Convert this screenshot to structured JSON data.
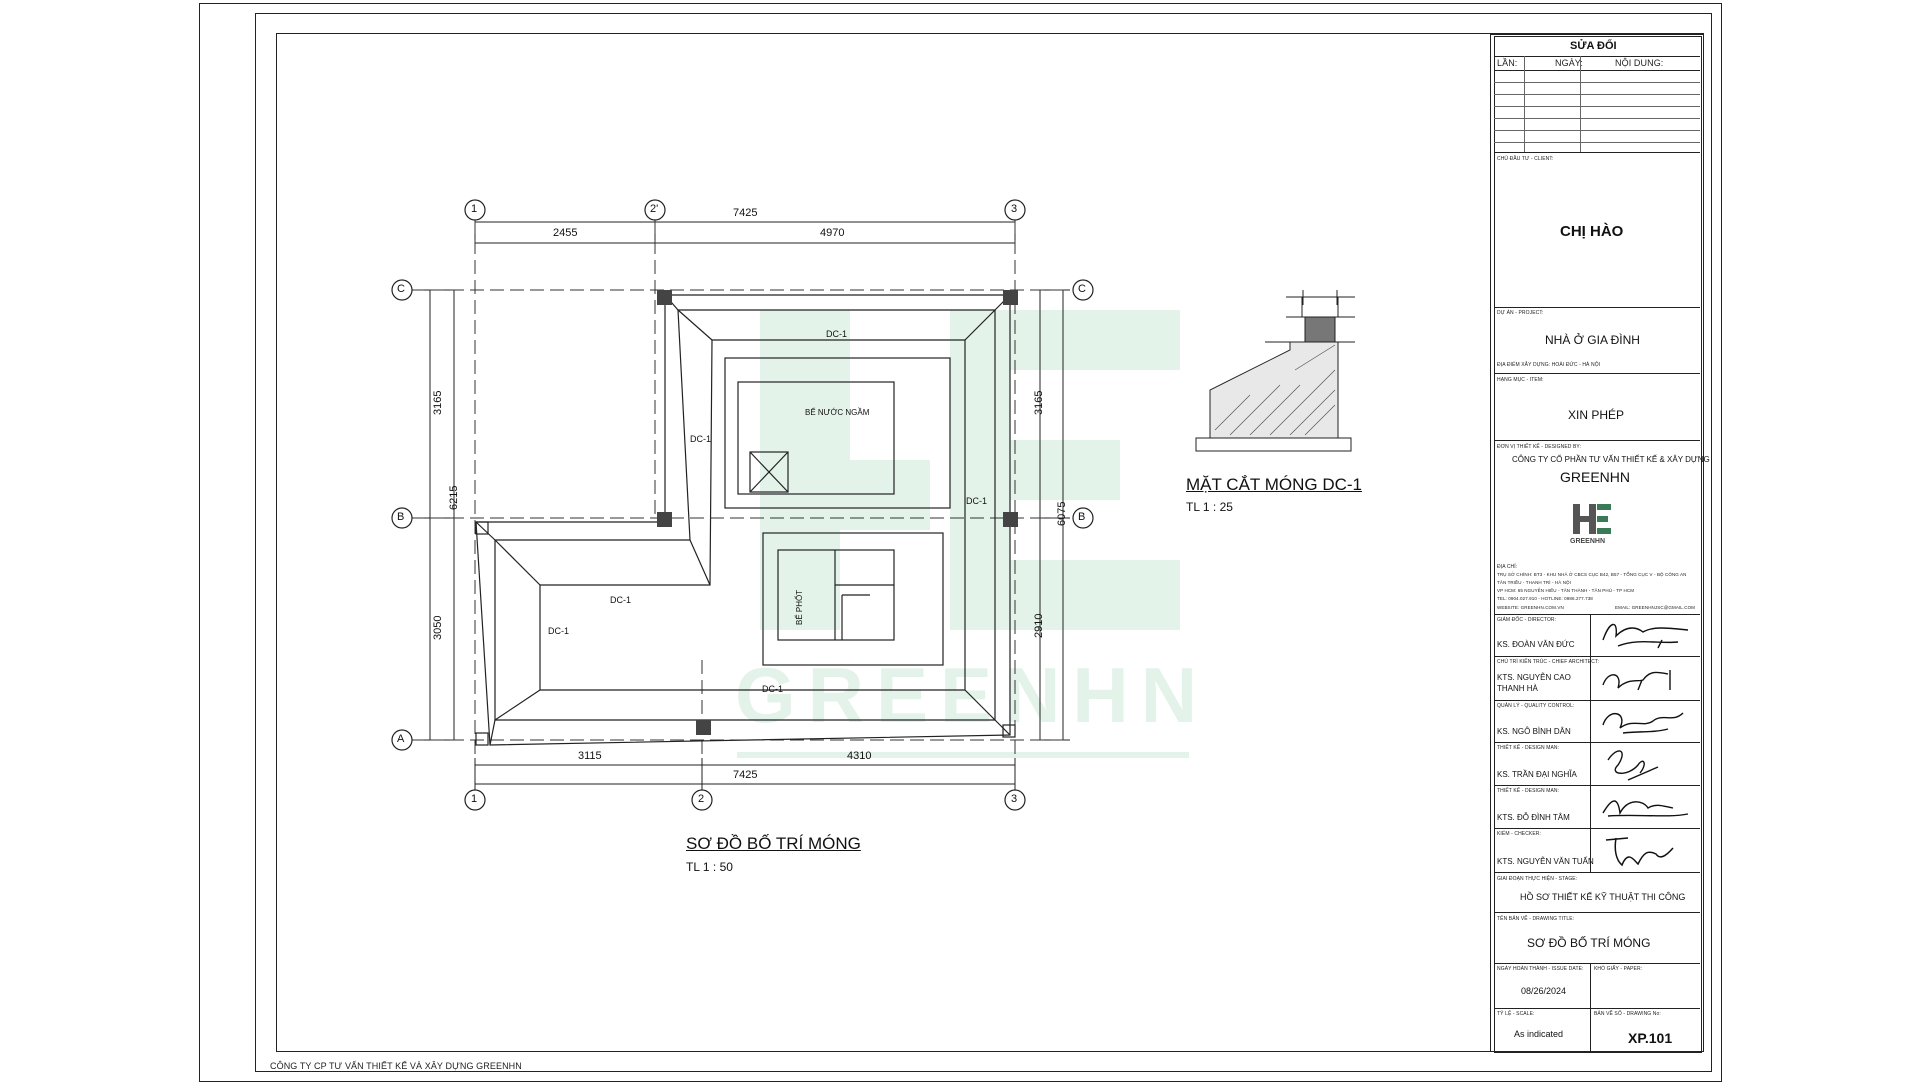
{
  "revisions": {
    "title": "SỬA ĐỔI",
    "col_lan": "LẦN:",
    "col_ngay": "NGÀY:",
    "col_noidung": "NỘI DUNG:"
  },
  "client": {
    "label": "CHỦ ĐẦU TƯ - CLIENT:",
    "name": "CHỊ HÀO"
  },
  "project": {
    "label": "DỰ ÁN - PROJECT:",
    "name": "NHÀ Ở GIA ĐÌNH",
    "location": "ĐỊA ĐIỂM XÂY DỰNG: HOÀI ĐỨC - HÀ NỘI"
  },
  "category": {
    "label": "HẠNG MỤC - ITEM:",
    "name": "XIN PHÉP"
  },
  "designer": {
    "label": "ĐƠN VỊ THIẾT KẾ - DESIGNED BY:",
    "company": "CÔNG TY CỔ PHẦN TƯ VẤN THIẾT KẾ & XÂY DỰNG",
    "brand": "GREENHN",
    "logo_text": "GREENHN",
    "address_label": "ĐỊA CHỈ:",
    "address_1": "TRỤ SỞ CHÍNH: BT3 - KHU NHÀ Ở CBCS CỤC B42, B57 - TỔNG CỤC V - BỘ CÔNG AN",
    "address_2": "TÂN TRIỀU - THANH TRÌ - HÀ NỘI",
    "address_3": "VP HCM: 65 NGUYỄN HIẾU - TÂN THÀNH - TÂN PHÚ - TP HCM",
    "address_4": "TEL: 0904.027.910 - HOTLINE: 0986.277.738",
    "website": "WEBSITE: GREENHN.COM.VN",
    "email": "EMAIL: GREENHNJSC@GMAIL.COM"
  },
  "signers": [
    {
      "role": "GIÁM ĐỐC - DIRECTOR:",
      "name": "KS. ĐOÀN VĂN ĐỨC"
    },
    {
      "role": "CHỦ TRÌ KIẾN TRÚC - CHIEF ARCHITECT:",
      "name": "KTS. NGUYỄN CAO THANH HÀ"
    },
    {
      "role": "QUẢN LÝ - QUALITY CONTROL:",
      "name": "KS. NGÔ BÌNH DÂN"
    },
    {
      "role": "THIẾT KẾ - DESIGN MAN:",
      "name": "KS. TRẦN ĐẠI NGHĨA"
    },
    {
      "role": "THIẾT KẾ - DESIGN MAN:",
      "name": "KTS. ĐỖ ĐÌNH TÂM"
    },
    {
      "role": "KIỂM - CHECKER:",
      "name": "KTS. NGUYỄN VĂN TUẤN"
    }
  ],
  "stage": {
    "label": "GIAI ĐOẠN THỰC HIỆN - STAGE:",
    "name": "HỒ SƠ THIẾT KẾ KỸ THUẬT THI CÔNG"
  },
  "drawing": {
    "label": "TÊN BẢN VẼ - DRAWING TITLE:",
    "name": "SƠ ĐỒ BỐ TRÍ MÓNG"
  },
  "dates": {
    "date_label": "NGÀY HOÀN THÀNH - ISSUE DATE:",
    "date_value": "08/26/2024",
    "paper_label": "KHỔ GIẤY - PAPER:",
    "scale_label": "TỶ LỆ - SCALE:",
    "scale_value": "As indicated",
    "number_label": "BẢN VẼ SỐ - DRAWING No:",
    "number_value": "XP.101"
  },
  "footer_company": "CÔNG TY CP TƯ VẤN THIẾT KẾ VÀ XÂY DỰNG GREENHN",
  "plan": {
    "title": "SƠ ĐỒ BỐ TRÍ MÓNG",
    "scale": "TL 1 : 50",
    "grid_cols": [
      "1",
      "2'",
      "3",
      "1",
      "2",
      "3"
    ],
    "grid_rows": [
      "C",
      "B",
      "A",
      "C",
      "B"
    ],
    "dims_top_total": "7425",
    "dims_top_a": "2455",
    "dims_top_b": "4970",
    "dims_bot_a": "3115",
    "dims_bot_b": "4310",
    "dims_bot_total": "7425",
    "dims_left_total": "6215",
    "dims_left_a": "3165",
    "dims_left_b": "3050",
    "dims_right_a": "3165",
    "dims_right_b": "2910",
    "dims_right_total": "6075",
    "foundation_labels": [
      "DC-1",
      "DC-1",
      "DC-1",
      "DC-1",
      "DC-1",
      "DC-1"
    ],
    "tank_label": "BỂ NƯỚC NGẦM",
    "septic_label": "BỂ PHỐT"
  },
  "section": {
    "title": "MẶT CẮT MÓNG DC-1",
    "scale": "TL 1 : 25"
  },
  "watermark": "GREENHN"
}
